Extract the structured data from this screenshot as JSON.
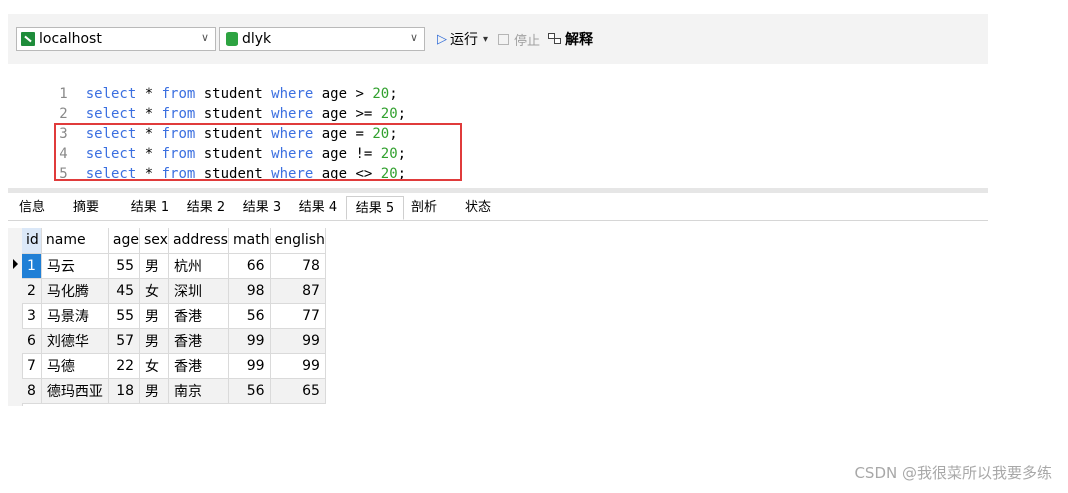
{
  "toolbar": {
    "connection": "localhost",
    "database": "dlyk",
    "run_label": "运行",
    "stop_label": "停止",
    "explain_label": "解释"
  },
  "editor": {
    "lines": [
      {
        "n": "1",
        "kw1": "select",
        "a": " * ",
        "kw2": "from",
        "b": " student ",
        "kw3": "where",
        "c": " age > ",
        "num": "20",
        "d": ";"
      },
      {
        "n": "2",
        "kw1": "select",
        "a": " * ",
        "kw2": "from",
        "b": " student ",
        "kw3": "where",
        "c": " age >= ",
        "num": "20",
        "d": ";"
      },
      {
        "n": "3",
        "kw1": "select",
        "a": " * ",
        "kw2": "from",
        "b": " student ",
        "kw3": "where",
        "c": " age = ",
        "num": "20",
        "d": ";"
      },
      {
        "n": "4",
        "kw1": "select",
        "a": " * ",
        "kw2": "from",
        "b": " student ",
        "kw3": "where",
        "c": " age != ",
        "num": "20",
        "d": ";"
      },
      {
        "n": "5",
        "kw1": "select",
        "a": " * ",
        "kw2": "from",
        "b": " student ",
        "kw3": "where",
        "c": " age <> ",
        "num": "20",
        "d": ";"
      }
    ]
  },
  "tabs": [
    "信息",
    "摘要",
    "结果 1",
    "结果 2",
    "结果 3",
    "结果 4",
    "结果 5",
    "剖析",
    "状态"
  ],
  "grid": {
    "columns": [
      "id",
      "name",
      "age",
      "sex",
      "address",
      "math",
      "english"
    ],
    "rows": [
      [
        "1",
        "马云",
        "55",
        "男",
        "杭州",
        "66",
        "78"
      ],
      [
        "2",
        "马化腾",
        "45",
        "女",
        "深圳",
        "98",
        "87"
      ],
      [
        "3",
        "马景涛",
        "55",
        "男",
        "香港",
        "56",
        "77"
      ],
      [
        "6",
        "刘德华",
        "57",
        "男",
        "香港",
        "99",
        "99"
      ],
      [
        "7",
        "马德",
        "22",
        "女",
        "香港",
        "99",
        "99"
      ],
      [
        "8",
        "德玛西亚",
        "18",
        "男",
        "南京",
        "56",
        "65"
      ]
    ]
  },
  "watermark": "CSDN @我很菜所以我要多练",
  "colors": {
    "keyword": "#3b6fe0",
    "number": "#31a02e",
    "highlight_box": "#e03b3b",
    "selected_cell": "#1f7fd6"
  }
}
